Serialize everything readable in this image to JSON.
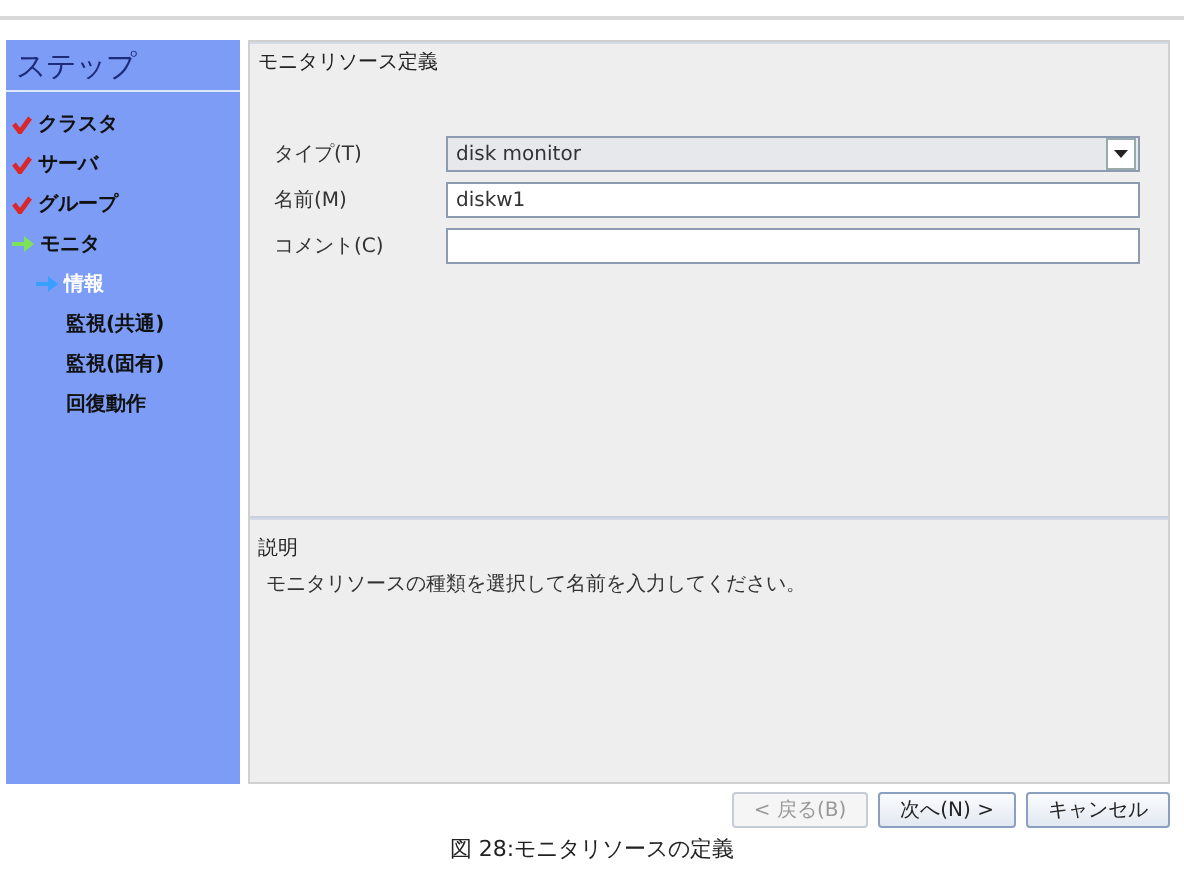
{
  "sidebar": {
    "title": "ステップ",
    "steps": [
      {
        "label": "クラスタ",
        "done": true,
        "current": false
      },
      {
        "label": "サーバ",
        "done": true,
        "current": false
      },
      {
        "label": "グループ",
        "done": true,
        "current": false
      },
      {
        "label": "モニタ",
        "done": false,
        "current": true,
        "children": [
          {
            "label": "情報",
            "current": true
          },
          {
            "label": "監視(共通)",
            "current": false
          },
          {
            "label": "監視(固有)",
            "current": false
          },
          {
            "label": "回復動作",
            "current": false
          }
        ]
      }
    ]
  },
  "definition": {
    "title": "モニタリソース定義",
    "fields": [
      {
        "kind": "dropdown",
        "label": "タイプ(T)",
        "value": "disk monitor"
      },
      {
        "kind": "text",
        "label": "名前(M)",
        "value": "diskw1"
      },
      {
        "kind": "text",
        "label": "コメント(C)"
      }
    ]
  },
  "description": {
    "title": "説明",
    "text": "モニタリソースの種類を選択して名前を入力してください。"
  },
  "buttons": [
    {
      "label": "< 戻る(B)",
      "disabled": true
    },
    {
      "label": "次へ(N) >",
      "disabled": false
    },
    {
      "label": "キャンセル",
      "disabled": false
    }
  ],
  "caption": "図 28:モニタリソースの定義"
}
